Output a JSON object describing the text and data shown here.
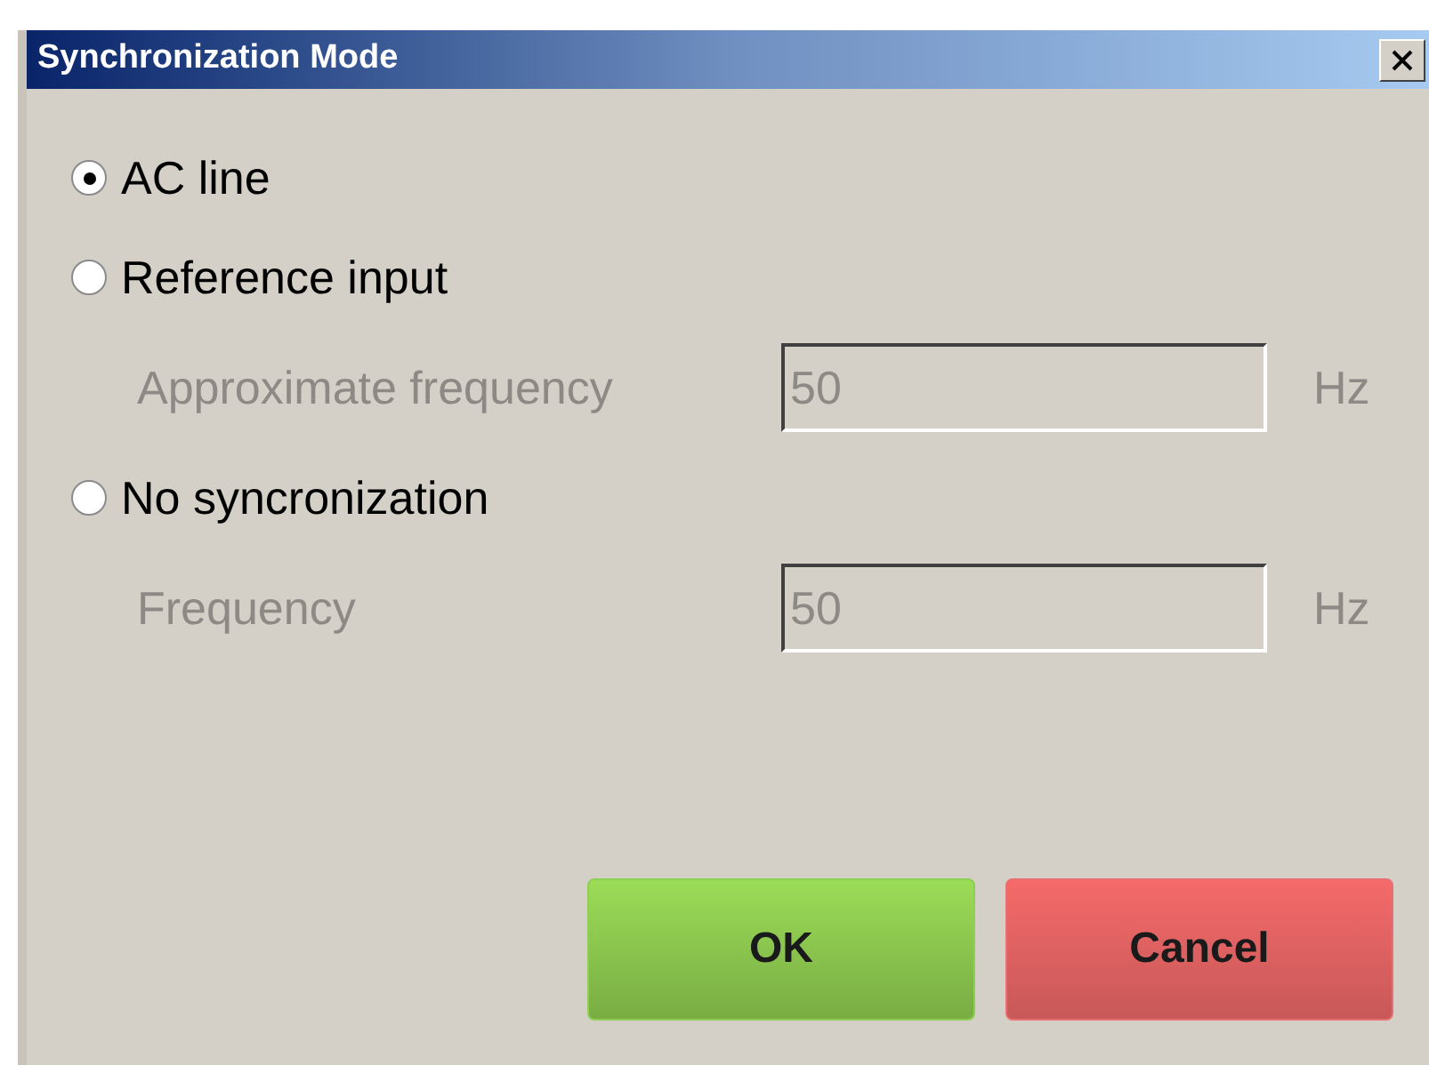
{
  "window": {
    "title": "Synchronization Mode"
  },
  "options": [
    {
      "label": "AC line",
      "selected": true
    },
    {
      "label": "Reference input",
      "selected": false,
      "field": {
        "label": "Approximate frequency",
        "value": "50",
        "unit": "Hz",
        "disabled": true
      }
    },
    {
      "label": "No syncronization",
      "selected": false,
      "field": {
        "label": "Frequency",
        "value": "50",
        "unit": "Hz",
        "disabled": true
      }
    }
  ],
  "buttons": [
    {
      "label": "OK",
      "kind": "ok"
    },
    {
      "label": "Cancel",
      "kind": "cancel"
    }
  ]
}
